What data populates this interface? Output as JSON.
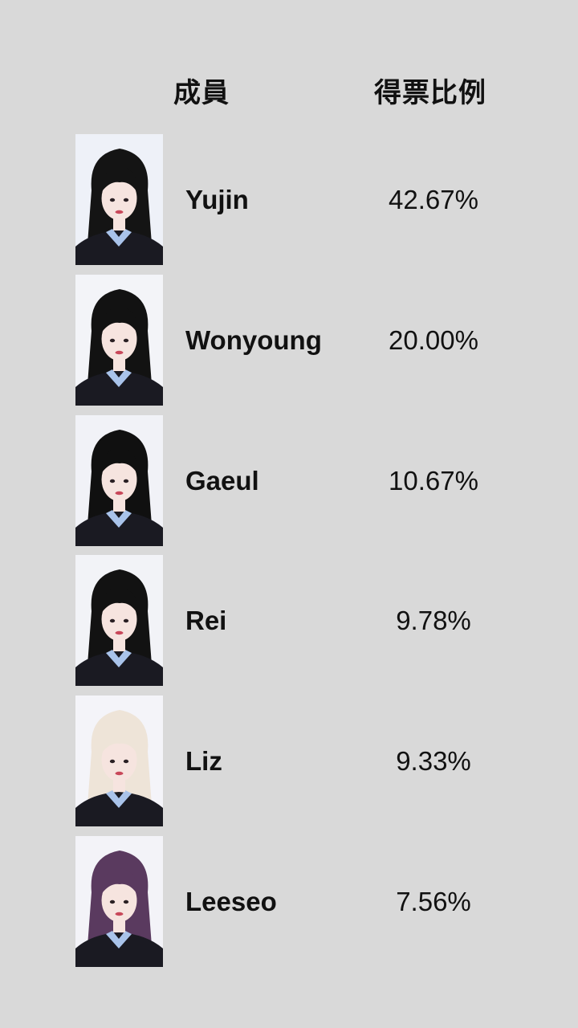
{
  "header": {
    "member_label": "成員",
    "ratio_label": "得票比例"
  },
  "members": [
    {
      "name": "Yujin",
      "percent": "42.67%",
      "hair_color": "#141414",
      "bg_color": "#eef1f8"
    },
    {
      "name": "Wonyoung",
      "percent": "20.00%",
      "hair_color": "#121212",
      "bg_color": "#f3f4f8"
    },
    {
      "name": "Gaeul",
      "percent": "10.67%",
      "hair_color": "#101010",
      "bg_color": "#f1f2f7"
    },
    {
      "name": "Rei",
      "percent": "9.78%",
      "hair_color": "#121212",
      "bg_color": "#f2f3f7"
    },
    {
      "name": "Liz",
      "percent": "9.33%",
      "hair_color": "#eee4d8",
      "bg_color": "#f4f4f9"
    },
    {
      "name": "Leeseo",
      "percent": "7.56%",
      "hair_color": "#5a3a5f",
      "bg_color": "#f3f3f8"
    }
  ],
  "colors": {
    "background": "#d9d9d9",
    "text": "#111111",
    "jacket": "#1a1a22",
    "collar": "#a9c3ea",
    "skin": "#f6e4df"
  }
}
